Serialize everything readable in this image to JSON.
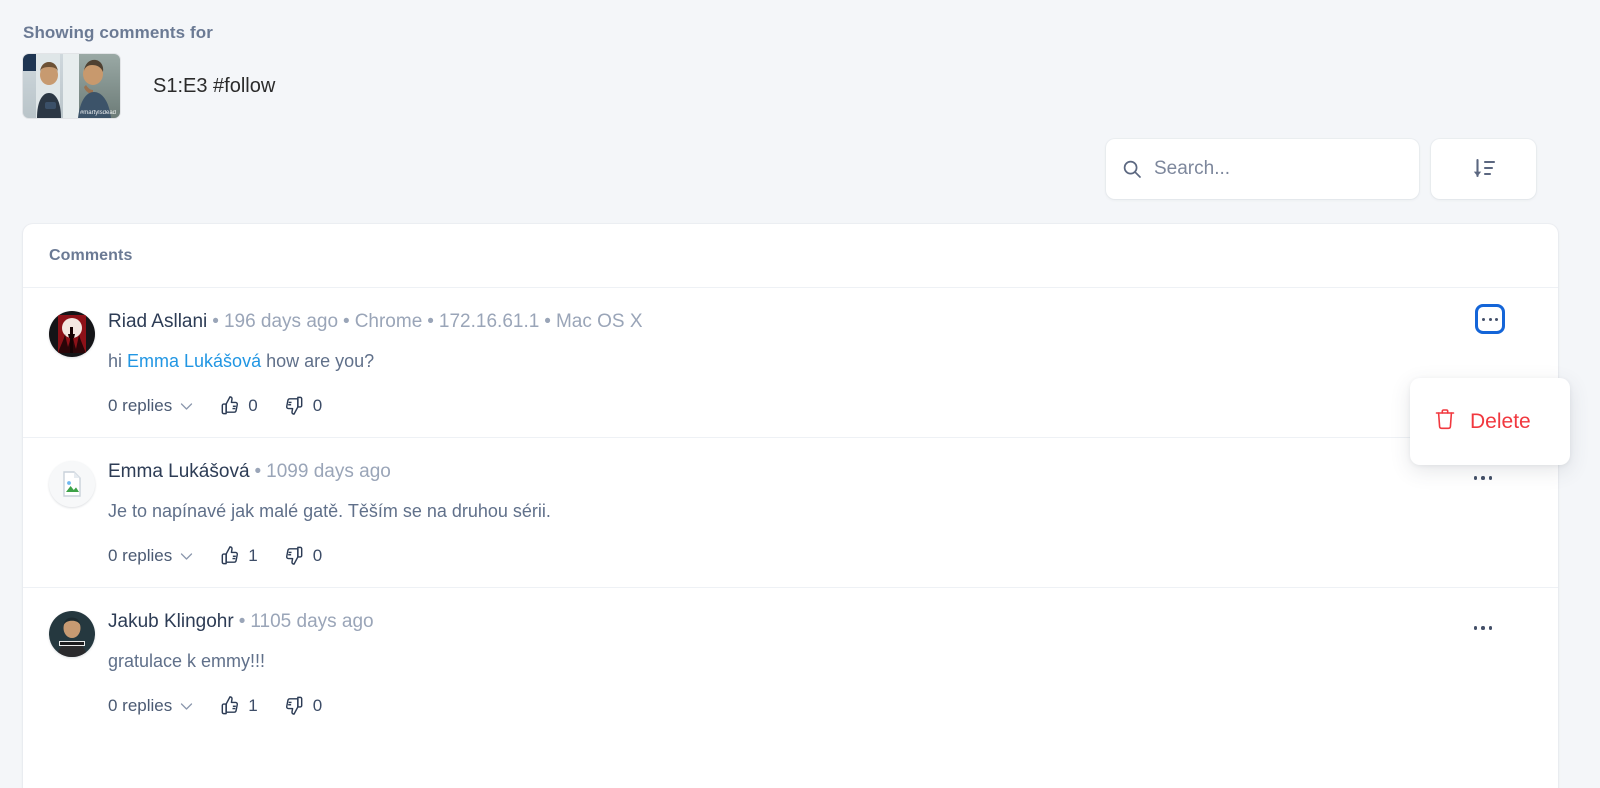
{
  "header": {
    "showing_title": "Showing comments for",
    "video_label": "S1:E3 #follow",
    "thumbnail_watermark": "#martylsdead"
  },
  "toolbar": {
    "search_value": "",
    "search_placeholder": "Search...",
    "search_icon": "search-icon",
    "sort_icon": "sort-descending-icon"
  },
  "comments_card": {
    "title": "Comments",
    "rows": [
      {
        "author": "Riad Asllani",
        "meta": [
          "196 days ago",
          "Chrome",
          "172.16.61.1",
          "Mac OS X"
        ],
        "text_before": "hi ",
        "mention": "Emma Lukášová",
        "text_after": " how are you?",
        "replies": "0 replies",
        "likes": "0",
        "dislikes": "0",
        "menu_open": true
      },
      {
        "author": "Emma Lukášová",
        "meta": [
          "1099 days ago"
        ],
        "text_before": "Je to napínavé jak malé gatě. Těším se na druhou sérii.",
        "mention": "",
        "text_after": "",
        "replies": "0 replies",
        "likes": "1",
        "dislikes": "0",
        "menu_open": false
      },
      {
        "author": "Jakub Klingohr",
        "meta": [
          "1105 days ago"
        ],
        "text_before": "gratulace k emmy!!!",
        "mention": "",
        "text_after": "",
        "replies": "0 replies",
        "likes": "1",
        "dislikes": "0",
        "menu_open": false
      }
    ]
  },
  "dropdown": {
    "delete_label": "Delete",
    "delete_icon": "trash-icon",
    "delete_color": "#f1383f"
  },
  "colors": {
    "page_background": "#f4f6f9",
    "card_background": "#ffffff",
    "heading": "#6b7a94",
    "author": "#2d3c55",
    "meta": "#9aa5b8",
    "body_text": "#60708a",
    "mention_link": "#2196e3",
    "focus_border": "#1465d8",
    "danger": "#f1383f"
  }
}
